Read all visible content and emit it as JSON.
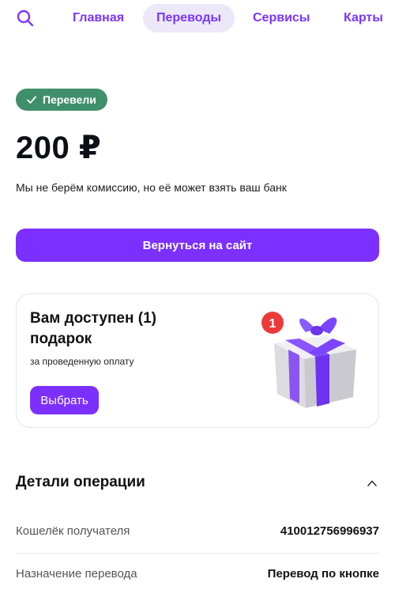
{
  "nav": {
    "tabs": [
      {
        "label": "Главная"
      },
      {
        "label": "Переводы",
        "active": true
      },
      {
        "label": "Сервисы"
      },
      {
        "label": "Карты"
      }
    ],
    "search_icon": "search-icon"
  },
  "status": {
    "label": "Перевели",
    "icon": "check-icon",
    "color": "#3f8f6c"
  },
  "amount": "200 ₽",
  "fee_note": "Мы не берём комиссию, но её может взять ваш банк",
  "return_button": "Вернуться на сайт",
  "gift": {
    "title": "Вам доступен (1) подарок",
    "subtitle": "за проведенную оплату",
    "button": "Выбрать",
    "badge_count": "1"
  },
  "details": {
    "title": "Детали операции",
    "rows": [
      {
        "label": "Кошелёк получателя",
        "value": "410012756996937"
      },
      {
        "label": "Назначение перевода",
        "value": "Перевод по кнопке"
      }
    ]
  },
  "colors": {
    "accent": "#7b30ff",
    "success": "#3f8f6c",
    "tab_active_bg": "#ece8f8"
  }
}
